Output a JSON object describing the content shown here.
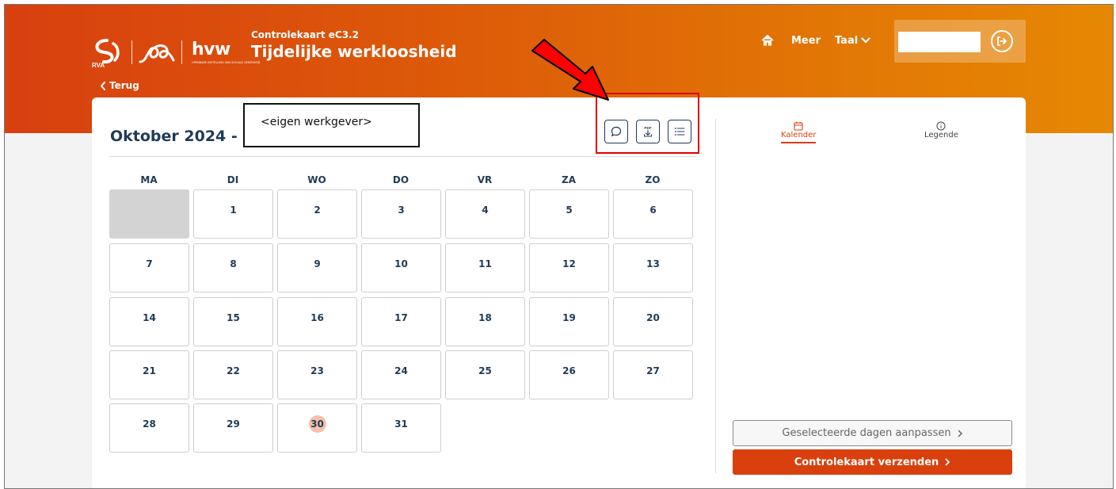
{
  "header": {
    "logo_rva_text": "RVA",
    "logo_hvw_text": "hvw",
    "logo_hvw_subtext": "OPENBARE INSTELLING VAN SOCIALE ZEKERHEID",
    "title_small": "Controlekaart eC3.2",
    "title_big": "Tijdelijke werkloosheid",
    "back_label": "Terug",
    "nav": {
      "meer": "Meer",
      "taal": "Taal"
    },
    "user_field_value": ""
  },
  "calendar": {
    "month_title": "Oktober 2024 -",
    "employer_label": "<eigen werkgever>",
    "weekdays": [
      "MA",
      "DI",
      "WO",
      "DO",
      "VR",
      "ZA",
      "ZO"
    ],
    "weeks": [
      [
        "",
        "1",
        "2",
        "3",
        "4",
        "5",
        "6"
      ],
      [
        "7",
        "8",
        "9",
        "10",
        "11",
        "12",
        "13"
      ],
      [
        "14",
        "15",
        "16",
        "17",
        "18",
        "19",
        "20"
      ],
      [
        "21",
        "22",
        "23",
        "24",
        "25",
        "26",
        "27"
      ],
      [
        "28",
        "29",
        "30",
        "31",
        null,
        null,
        null
      ]
    ],
    "today": "30",
    "action_icons": [
      "comment-icon",
      "pdf-download-icon",
      "list-icon"
    ]
  },
  "sidebar": {
    "tab_calendar": "Kalender",
    "tab_legend": "Legende",
    "adjust_button": "Geselecteerde dagen aanpassen",
    "send_button": "Controlekaart verzenden"
  },
  "colors": {
    "brand_orange": "#d9400d",
    "hero_gradient_end": "#e68803",
    "text_navy": "#1f3b57",
    "today_highlight": "#f6c0a8",
    "annotation_red": "#e10000"
  }
}
